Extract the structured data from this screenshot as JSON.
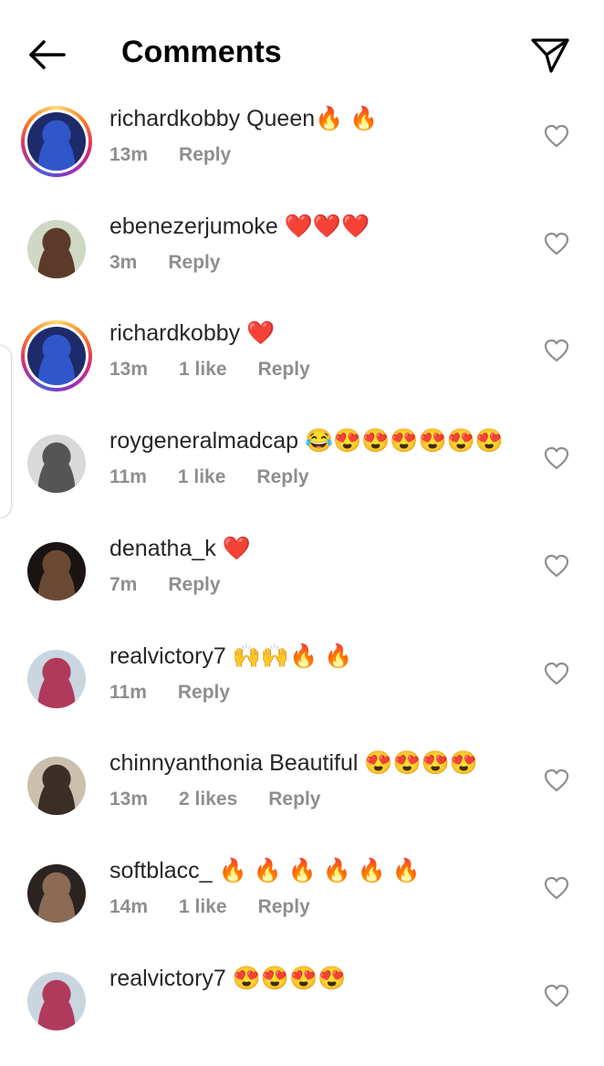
{
  "header": {
    "title": "Comments"
  },
  "comments": [
    {
      "username": "richardkobby",
      "text": " Queen🔥 🔥",
      "time": "13m",
      "likes": "",
      "reply": "Reply",
      "story": true,
      "avatar_bg": "#1d2b6b",
      "avatar_fg": "#3057c9"
    },
    {
      "username": "ebenezerjumoke",
      "text": " ❤️❤️❤️",
      "time": "3m",
      "likes": "",
      "reply": "Reply",
      "story": false,
      "avatar_bg": "#cfd8c4",
      "avatar_fg": "#5b3a2a"
    },
    {
      "username": "richardkobby",
      "text": " ❤️",
      "time": "13m",
      "likes": "1 like",
      "reply": "Reply",
      "story": true,
      "avatar_bg": "#1d2b6b",
      "avatar_fg": "#3057c9"
    },
    {
      "username": "roygeneralmadcap",
      "text": " 😂😍😍😍😍😍😍",
      "time": "11m",
      "likes": "1 like",
      "reply": "Reply",
      "story": false,
      "avatar_bg": "#d9d9d9",
      "avatar_fg": "#555555"
    },
    {
      "username": "denatha_k",
      "text": " ❤️",
      "time": "7m",
      "likes": "",
      "reply": "Reply",
      "story": false,
      "avatar_bg": "#1a1412",
      "avatar_fg": "#6b4a35"
    },
    {
      "username": "realvictory7",
      "text": " 🙌🙌🔥 🔥",
      "time": "11m",
      "likes": "",
      "reply": "Reply",
      "story": false,
      "avatar_bg": "#c9d6e0",
      "avatar_fg": "#b03a5b"
    },
    {
      "username": "chinnyanthonia",
      "text": " Beautiful 😍😍😍😍",
      "time": "13m",
      "likes": "2 likes",
      "reply": "Reply",
      "story": false,
      "avatar_bg": "#cbbfae",
      "avatar_fg": "#3b2e26"
    },
    {
      "username": "softblacc_",
      "text": " 🔥 🔥 🔥 🔥 🔥 🔥",
      "time": "14m",
      "likes": "1 like",
      "reply": "Reply",
      "story": false,
      "avatar_bg": "#2a2320",
      "avatar_fg": "#8b6b55"
    },
    {
      "username": "realvictory7",
      "text": " 😍😍😍😍",
      "time": "",
      "likes": "",
      "reply": "",
      "story": false,
      "avatar_bg": "#c9d6e0",
      "avatar_fg": "#b03a5b"
    }
  ]
}
